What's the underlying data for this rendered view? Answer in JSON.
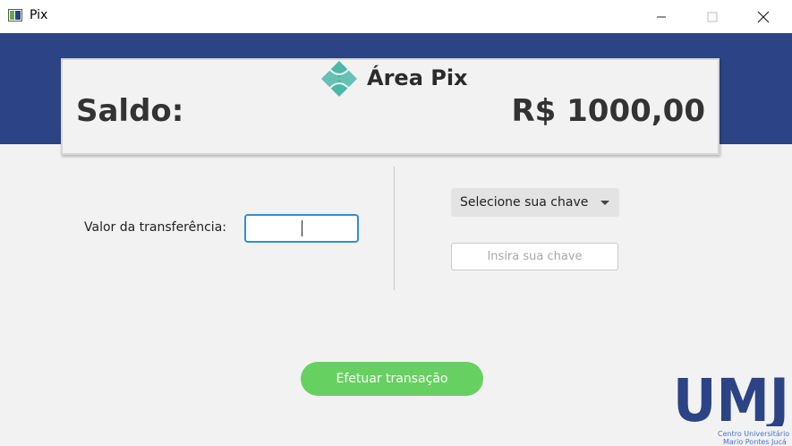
{
  "window": {
    "title": "Pix",
    "icon": "window-app-icon",
    "controls": {
      "minimize_icon": "minimize-icon",
      "maximize_icon": "maximize-icon",
      "close_icon": "close-icon"
    }
  },
  "header": {
    "title": "Área Pix",
    "logo_icon": "pix-logo-icon",
    "balance_label": "Saldo:",
    "balance_value": "R$ 1000,00"
  },
  "form": {
    "amount_label": "Valor da transferência:",
    "amount_value": "",
    "key_type_select": {
      "selected": "Selecione sua chave"
    },
    "key_input": {
      "value": "",
      "placeholder": "Insira sua chave"
    },
    "submit_label": "Efetuar transação"
  },
  "footer_logo": {
    "text": "UMJ",
    "subtitle_line1": "Centro Universitário",
    "subtitle_line2": "Mario Pontes Jucá"
  },
  "colors": {
    "banner": "#2c4485",
    "pix_teal": "#4bb8a8",
    "submit_green": "#66d160",
    "input_focus": "#2d8fd6",
    "umj_blue": "#2c4485"
  }
}
